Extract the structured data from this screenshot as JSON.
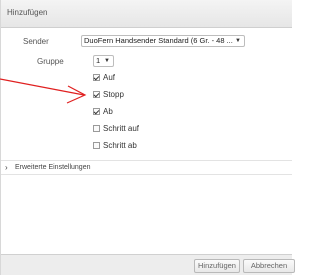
{
  "dialog": {
    "title": "Hinzufügen"
  },
  "form": {
    "sender_label": "Sender",
    "sender_value": "DuoFern Handsender Standard (6 Gr. - 48 ...",
    "gruppe_label": "Gruppe",
    "gruppe_value": "1"
  },
  "checkboxes": [
    {
      "label": "Auf",
      "checked": true
    },
    {
      "label": "Stopp",
      "checked": true
    },
    {
      "label": "Ab",
      "checked": true
    },
    {
      "label": "Schritt auf",
      "checked": false
    },
    {
      "label": "Schritt ab",
      "checked": false
    }
  ],
  "section": {
    "label": "Erweiterte Einstellungen"
  },
  "footer": {
    "add_label": "Hinzufügen",
    "cancel_label": "Abbrechen"
  },
  "icons": {
    "dropdown": "chevron-down-icon",
    "section": "chevron-right-icon",
    "annotation": "red-arrow-icon"
  },
  "colors": {
    "annotation_arrow": "#e02020"
  }
}
